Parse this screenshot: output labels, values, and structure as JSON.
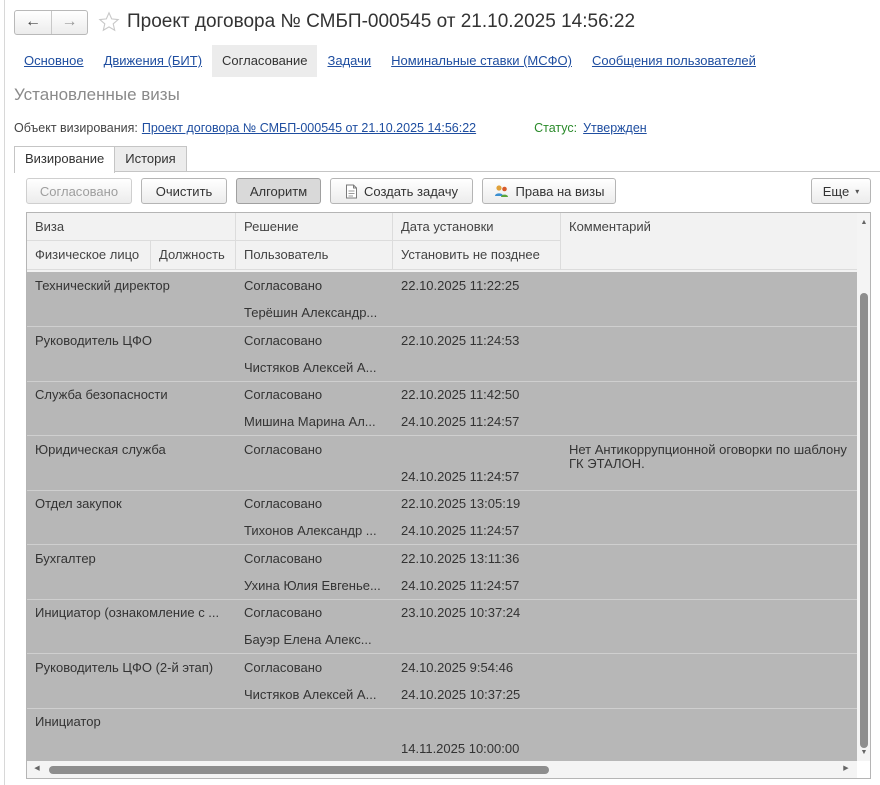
{
  "window": {
    "title": "Проект договора № СМБП-000545 от 21.10.2025 14:56:22",
    "back_icon": "arrow-left-icon",
    "forward_icon": "arrow-right-icon",
    "favorite_icon": "star-icon"
  },
  "nav": {
    "links": [
      "Основное",
      "Движения (БИТ)",
      "Согласование",
      "Задачи",
      "Номинальные ставки (МСФО)",
      "Сообщения пользователей"
    ],
    "active": "Согласование"
  },
  "heading": "Установленные визы",
  "object": {
    "label": "Объект визирования:",
    "link": "Проект договора № СМБП-000545 от 21.10.2025 14:56:22",
    "status_label": "Статус:",
    "status_value": "Утвержден"
  },
  "tabs": [
    "Визирование",
    "История"
  ],
  "toolbar": {
    "approved": "Согласовано",
    "clear": "Очистить",
    "algorithm": "Алгоритм",
    "create_task": "Создать задачу",
    "rights": "Права на визы",
    "more": "Еще"
  },
  "grid": {
    "headers": {
      "visa": "Виза",
      "decision": "Решение",
      "date": "Дата установки",
      "comment": "Комментарий",
      "person": "Физическое лицо",
      "position": "Должность",
      "user": "Пользователь",
      "deadline": "Установить не позднее"
    },
    "rows": [
      {
        "visa": "Технический директор",
        "decision": "Согласовано",
        "date": "22.10.2025 11:22:25",
        "user": "Терёшин Александр...",
        "deadline": "",
        "comment": ""
      },
      {
        "visa": "Руководитель ЦФО",
        "decision": "Согласовано",
        "date": "22.10.2025 11:24:53",
        "user": "Чистяков Алексей А...",
        "deadline": "",
        "comment": ""
      },
      {
        "visa": "Служба безопасности",
        "decision": "Согласовано",
        "date": "22.10.2025 11:42:50",
        "user": "Мишина Марина Ал...",
        "deadline": "24.10.2025 11:24:57",
        "comment": ""
      },
      {
        "visa": "Юридическая служба",
        "decision": "Согласовано",
        "date": "",
        "user": "",
        "deadline": "24.10.2025 11:24:57",
        "comment": "Нет Антикоррупционной оговорки по шаблону ГК ЭТАЛОН."
      },
      {
        "visa": "Отдел закупок",
        "decision": "Согласовано",
        "date": "22.10.2025 13:05:19",
        "user": "Тихонов Александр ...",
        "deadline": "24.10.2025 11:24:57",
        "comment": ""
      },
      {
        "visa": "Бухгалтер",
        "decision": "Согласовано",
        "date": "22.10.2025 13:11:36",
        "user": "Ухина Юлия Евгенье...",
        "deadline": "24.10.2025 11:24:57",
        "comment": ""
      },
      {
        "visa": "Инициатор (ознакомление с ...",
        "decision": "Согласовано",
        "date": "23.10.2025 10:37:24",
        "user": "Бауэр Елена Алекс...",
        "deadline": "",
        "comment": ""
      },
      {
        "visa": "Руководитель ЦФО (2-й этап)",
        "decision": "Согласовано",
        "date": "24.10.2025 9:54:46",
        "user": "Чистяков Алексей А...",
        "deadline": "24.10.2025 10:37:25",
        "comment": ""
      },
      {
        "visa": "Инициатор",
        "decision": "",
        "date": "",
        "user": "",
        "deadline": "14.11.2025 10:00:00",
        "comment": ""
      }
    ]
  }
}
